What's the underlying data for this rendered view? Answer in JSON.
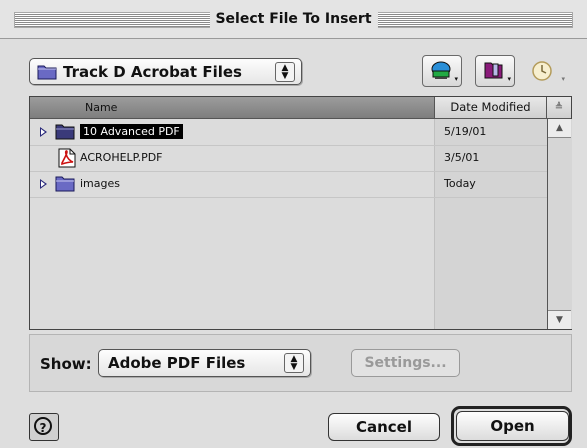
{
  "window": {
    "title": "Select File To Insert"
  },
  "location": {
    "current_folder": "Track D Acrobat Files",
    "folder_icon": "folder-icon"
  },
  "toolbar": {
    "shortcuts_icon": "shortcuts-icon",
    "favorites_icon": "favorites-icon",
    "recent_icon": "recent-icon"
  },
  "list": {
    "headers": {
      "name": "Name",
      "date_modified": "Date Modified"
    },
    "rows": [
      {
        "name": "10 Advanced PDF",
        "date": "5/19/01",
        "kind": "folder",
        "selected": true
      },
      {
        "name": "ACROHELP.PDF",
        "date": "3/5/01",
        "kind": "pdf",
        "selected": false
      },
      {
        "name": "images",
        "date": "Today",
        "kind": "folder",
        "selected": false
      }
    ]
  },
  "filter": {
    "show_label": "Show:",
    "selected": "Adobe PDF Files",
    "settings_label": "Settings..."
  },
  "buttons": {
    "cancel": "Cancel",
    "open": "Open",
    "help": "?"
  },
  "colors": {
    "selection": "#000000",
    "folder": "#5a5ab0",
    "pdf_red": "#cc1111"
  }
}
